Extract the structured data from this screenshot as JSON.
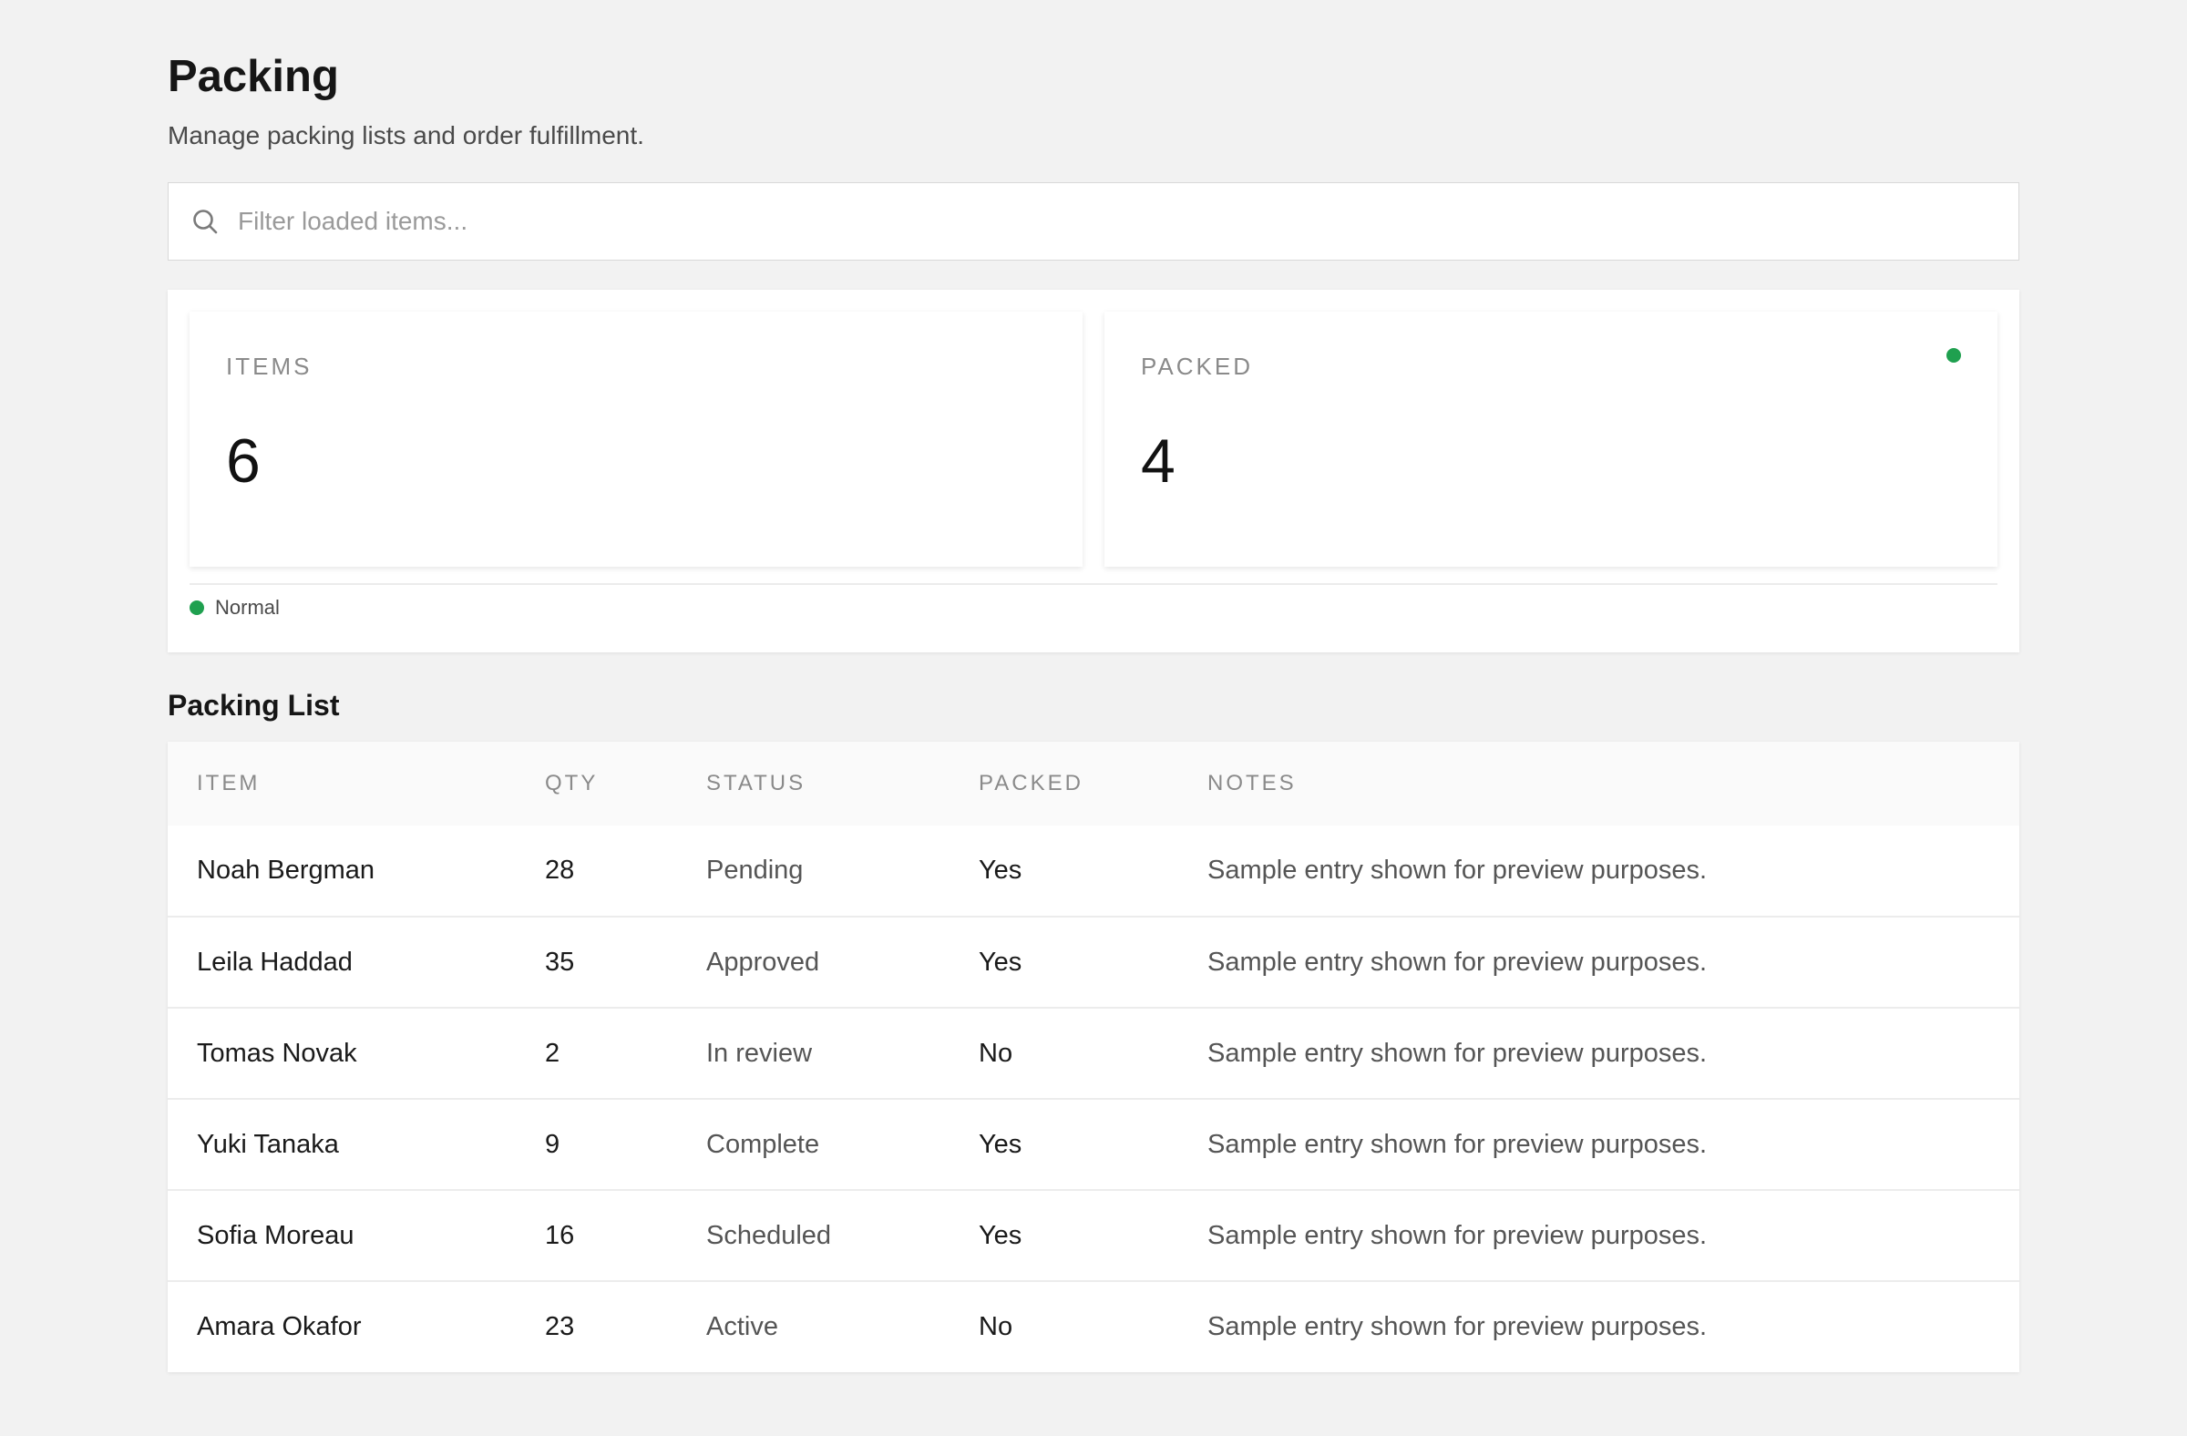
{
  "header": {
    "title": "Packing",
    "subtitle": "Manage packing lists and order fulfillment."
  },
  "search": {
    "placeholder": "Filter loaded items...",
    "icon": "search-icon"
  },
  "stats": {
    "cards": [
      {
        "label": "ITEMS",
        "value": "6"
      },
      {
        "label": "PACKED",
        "value": "4",
        "indicator_color": "#1fa04f"
      }
    ],
    "status": {
      "text": "Normal",
      "color": "#1fa04f"
    }
  },
  "packing_list": {
    "title": "Packing List",
    "columns": [
      "ITEM",
      "QTY",
      "STATUS",
      "PACKED",
      "NOTES"
    ],
    "rows": [
      {
        "item": "Noah Bergman",
        "qty": "28",
        "status": "Pending",
        "packed": "Yes",
        "notes": "Sample entry shown for preview purposes."
      },
      {
        "item": "Leila Haddad",
        "qty": "35",
        "status": "Approved",
        "packed": "Yes",
        "notes": "Sample entry shown for preview purposes."
      },
      {
        "item": "Tomas Novak",
        "qty": "2",
        "status": "In review",
        "packed": "No",
        "notes": "Sample entry shown for preview purposes."
      },
      {
        "item": "Yuki Tanaka",
        "qty": "9",
        "status": "Complete",
        "packed": "Yes",
        "notes": "Sample entry shown for preview purposes."
      },
      {
        "item": "Sofia Moreau",
        "qty": "16",
        "status": "Scheduled",
        "packed": "Yes",
        "notes": "Sample entry shown for preview purposes."
      },
      {
        "item": "Amara Okafor",
        "qty": "23",
        "status": "Active",
        "packed": "No",
        "notes": "Sample entry shown for preview purposes."
      }
    ]
  }
}
